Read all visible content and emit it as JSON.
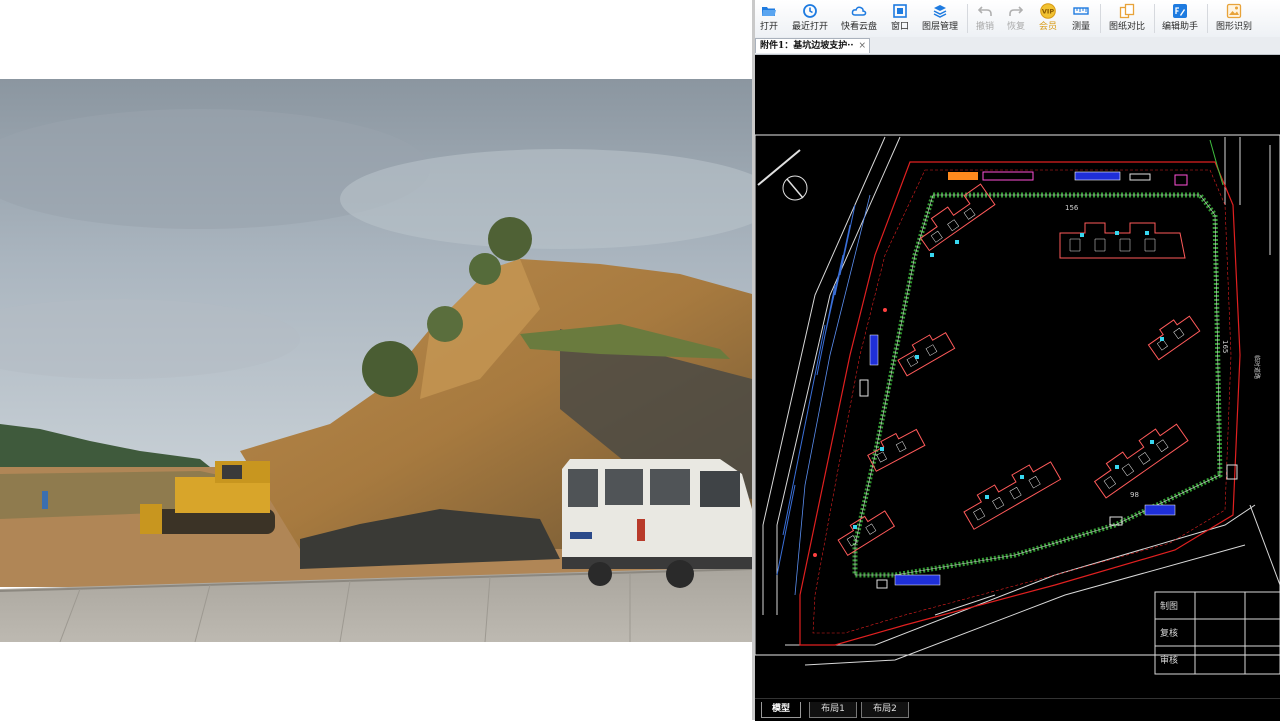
{
  "toolbar": {
    "items": [
      {
        "label": "打开",
        "icon": "folder-open-icon",
        "color": "#1e7be0"
      },
      {
        "label": "最近打开",
        "icon": "clock-icon",
        "color": "#1e7be0"
      },
      {
        "label": "快看云盘",
        "icon": "cloud-icon",
        "color": "#1e7be0"
      },
      {
        "label": "窗口",
        "icon": "window-icon",
        "color": "#1e7be0"
      },
      {
        "label": "图层管理",
        "icon": "layers-icon",
        "color": "#1e7be0"
      },
      {
        "label": "撤销",
        "icon": "undo-icon",
        "color": "#b0b0b0"
      },
      {
        "label": "恢复",
        "icon": "redo-icon",
        "color": "#b0b0b0"
      },
      {
        "label": "会员",
        "icon": "vip-badge-icon",
        "color": "#e6b422"
      },
      {
        "label": "测量",
        "icon": "ruler-icon",
        "color": "#1e7be0"
      },
      {
        "label": "图纸对比",
        "icon": "compare-icon",
        "color": "#e8a33a"
      },
      {
        "label": "编辑助手",
        "icon": "edit-assistant-icon",
        "color": "#1e7be0"
      },
      {
        "label": "图形识别",
        "icon": "image-recognition-icon",
        "color": "#e8a33a"
      }
    ]
  },
  "document_tab": {
    "title": "附件1：基坑边坡支护··",
    "close": "×"
  },
  "drawing": {
    "dimension_top": "156",
    "dimension_right": "165",
    "dimension_bottom": "98",
    "side_note": "临时道路",
    "title_block": [
      "制图",
      "复核",
      "审核"
    ]
  },
  "layout_tabs": [
    "模型",
    "布局1",
    "布局2"
  ],
  "colors": {
    "cad_background": "#000000",
    "boundary_red": "#e02020",
    "pit_green": "#3fbf3f",
    "building_red": "#ff5a5a"
  }
}
